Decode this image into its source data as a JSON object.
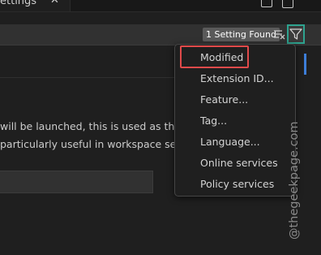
{
  "editor": {
    "tab_label": "ettings",
    "tab_close": "✕"
  },
  "search": {
    "result_badge": "1 Setting Found"
  },
  "setting": {
    "description_line1": "will be launched, this is used as the cu",
    "description_line2": "particularly useful in workspace setting"
  },
  "filter_menu": {
    "items": [
      {
        "label": "Modified",
        "highlighted": true
      },
      {
        "label": "Extension ID..."
      },
      {
        "label": "Feature..."
      },
      {
        "label": "Tag..."
      },
      {
        "label": "Language..."
      },
      {
        "label": "Online services"
      },
      {
        "label": "Policy services"
      }
    ]
  },
  "watermark": "@thegeekpage.com",
  "colors": {
    "highlight_outline": "#e04a4a",
    "filter_outline": "#2ea38f",
    "scrollbar_accent": "#3d7ed8"
  },
  "icons": [
    "close-icon",
    "run-icon",
    "split-editor-icon",
    "clear-filters-icon",
    "filter-icon"
  ]
}
